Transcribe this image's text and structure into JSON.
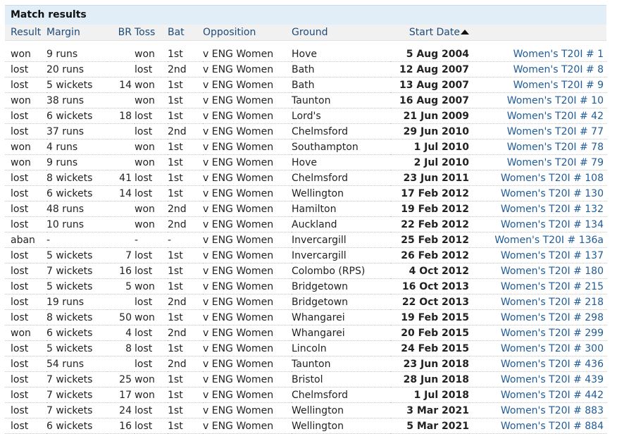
{
  "caption": "Match results",
  "headers": {
    "result": "Result",
    "margin": "Margin",
    "br": "BR",
    "toss": "Toss",
    "bat": "Bat",
    "opposition": "Opposition",
    "ground": "Ground",
    "start_date": "Start Date",
    "link": ""
  },
  "sort": {
    "column": "start_date",
    "direction": "ascending",
    "icon": "sort-ascending-icon"
  },
  "colors": {
    "link": "#1f5c99",
    "header_text": "#1e4b7a",
    "caption_bg": "#e1eef8"
  },
  "rows": [
    {
      "result": "won",
      "margin": "9 runs",
      "br": "",
      "toss": "won",
      "bat": "1st",
      "opposition": "v ENG Women",
      "ground": "Hove",
      "start_date": "5 Aug 2004",
      "link": "Women's T20I # 1"
    },
    {
      "result": "lost",
      "margin": "20 runs",
      "br": "",
      "toss": "lost",
      "bat": "2nd",
      "opposition": "v ENG Women",
      "ground": "Bath",
      "start_date": "12 Aug 2007",
      "link": "Women's T20I # 8"
    },
    {
      "result": "lost",
      "margin": "5 wickets",
      "br": "14",
      "toss": "won",
      "bat": "1st",
      "opposition": "v ENG Women",
      "ground": "Bath",
      "start_date": "13 Aug 2007",
      "link": "Women's T20I # 9"
    },
    {
      "result": "won",
      "margin": "38 runs",
      "br": "",
      "toss": "won",
      "bat": "1st",
      "opposition": "v ENG Women",
      "ground": "Taunton",
      "start_date": "16 Aug 2007",
      "link": "Women's T20I # 10"
    },
    {
      "result": "lost",
      "margin": "6 wickets",
      "br": "18",
      "toss": "lost",
      "bat": "1st",
      "opposition": "v ENG Women",
      "ground": "Lord's",
      "start_date": "21 Jun 2009",
      "link": "Women's T20I # 42"
    },
    {
      "result": "lost",
      "margin": "37 runs",
      "br": "",
      "toss": "lost",
      "bat": "2nd",
      "opposition": "v ENG Women",
      "ground": "Chelmsford",
      "start_date": "29 Jun 2010",
      "link": "Women's T20I # 77"
    },
    {
      "result": "won",
      "margin": "4 runs",
      "br": "",
      "toss": "won",
      "bat": "1st",
      "opposition": "v ENG Women",
      "ground": "Southampton",
      "start_date": "1 Jul 2010",
      "link": "Women's T20I # 78"
    },
    {
      "result": "won",
      "margin": "9 runs",
      "br": "",
      "toss": "won",
      "bat": "1st",
      "opposition": "v ENG Women",
      "ground": "Hove",
      "start_date": "2 Jul 2010",
      "link": "Women's T20I # 79"
    },
    {
      "result": "lost",
      "margin": "8 wickets",
      "br": "41",
      "toss": "lost",
      "bat": "1st",
      "opposition": "v ENG Women",
      "ground": "Chelmsford",
      "start_date": "23 Jun 2011",
      "link": "Women's T20I # 108"
    },
    {
      "result": "lost",
      "margin": "6 wickets",
      "br": "14",
      "toss": "lost",
      "bat": "1st",
      "opposition": "v ENG Women",
      "ground": "Wellington",
      "start_date": "17 Feb 2012",
      "link": "Women's T20I # 130"
    },
    {
      "result": "lost",
      "margin": "48 runs",
      "br": "",
      "toss": "won",
      "bat": "2nd",
      "opposition": "v ENG Women",
      "ground": "Hamilton",
      "start_date": "19 Feb 2012",
      "link": "Women's T20I # 132"
    },
    {
      "result": "lost",
      "margin": "10 runs",
      "br": "",
      "toss": "won",
      "bat": "2nd",
      "opposition": "v ENG Women",
      "ground": "Auckland",
      "start_date": "22 Feb 2012",
      "link": "Women's T20I # 134"
    },
    {
      "result": "aban",
      "margin": "-",
      "br": "",
      "toss": "-",
      "bat": "-",
      "opposition": "v ENG Women",
      "ground": "Invercargill",
      "start_date": "25 Feb 2012",
      "link": "Women's T20I # 136a"
    },
    {
      "result": "lost",
      "margin": "5 wickets",
      "br": "7",
      "toss": "lost",
      "bat": "1st",
      "opposition": "v ENG Women",
      "ground": "Invercargill",
      "start_date": "26 Feb 2012",
      "link": "Women's T20I # 137"
    },
    {
      "result": "lost",
      "margin": "7 wickets",
      "br": "16",
      "toss": "lost",
      "bat": "1st",
      "opposition": "v ENG Women",
      "ground": "Colombo (RPS)",
      "start_date": "4 Oct 2012",
      "link": "Women's T20I # 180"
    },
    {
      "result": "lost",
      "margin": "5 wickets",
      "br": "5",
      "toss": "won",
      "bat": "1st",
      "opposition": "v ENG Women",
      "ground": "Bridgetown",
      "start_date": "16 Oct 2013",
      "link": "Women's T20I # 215"
    },
    {
      "result": "lost",
      "margin": "19 runs",
      "br": "",
      "toss": "lost",
      "bat": "2nd",
      "opposition": "v ENG Women",
      "ground": "Bridgetown",
      "start_date": "22 Oct 2013",
      "link": "Women's T20I # 218"
    },
    {
      "result": "lost",
      "margin": "8 wickets",
      "br": "50",
      "toss": "won",
      "bat": "1st",
      "opposition": "v ENG Women",
      "ground": "Whangarei",
      "start_date": "19 Feb 2015",
      "link": "Women's T20I # 298"
    },
    {
      "result": "won",
      "margin": "6 wickets",
      "br": "4",
      "toss": "lost",
      "bat": "2nd",
      "opposition": "v ENG Women",
      "ground": "Whangarei",
      "start_date": "20 Feb 2015",
      "link": "Women's T20I # 299"
    },
    {
      "result": "lost",
      "margin": "5 wickets",
      "br": "8",
      "toss": "lost",
      "bat": "1st",
      "opposition": "v ENG Women",
      "ground": "Lincoln",
      "start_date": "24 Feb 2015",
      "link": "Women's T20I # 300"
    },
    {
      "result": "lost",
      "margin": "54 runs",
      "br": "",
      "toss": "lost",
      "bat": "2nd",
      "opposition": "v ENG Women",
      "ground": "Taunton",
      "start_date": "23 Jun 2018",
      "link": "Women's T20I # 436"
    },
    {
      "result": "lost",
      "margin": "7 wickets",
      "br": "25",
      "toss": "won",
      "bat": "1st",
      "opposition": "v ENG Women",
      "ground": "Bristol",
      "start_date": "28 Jun 2018",
      "link": "Women's T20I # 439"
    },
    {
      "result": "lost",
      "margin": "7 wickets",
      "br": "17",
      "toss": "won",
      "bat": "1st",
      "opposition": "v ENG Women",
      "ground": "Chelmsford",
      "start_date": "1 Jul 2018",
      "link": "Women's T20I # 442"
    },
    {
      "result": "lost",
      "margin": "7 wickets",
      "br": "24",
      "toss": "lost",
      "bat": "1st",
      "opposition": "v ENG Women",
      "ground": "Wellington",
      "start_date": "3 Mar 2021",
      "link": "Women's T20I # 883"
    },
    {
      "result": "lost",
      "margin": "6 wickets",
      "br": "16",
      "toss": "lost",
      "bat": "1st",
      "opposition": "v ENG Women",
      "ground": "Wellington",
      "start_date": "5 Mar 2021",
      "link": "Women's T20I # 884"
    }
  ]
}
